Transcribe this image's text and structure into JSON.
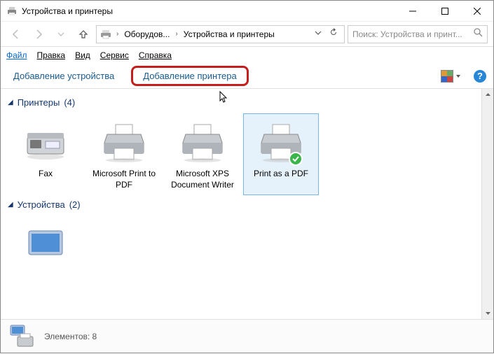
{
  "window": {
    "title": "Устройства и принтеры"
  },
  "breadcrumb": {
    "item1": "Оборудов...",
    "item2": "Устройства и принтеры"
  },
  "search": {
    "placeholder": "Поиск: Устройства и принт..."
  },
  "menu": {
    "file": "Файл",
    "edit": "Правка",
    "view": "Вид",
    "tools": "Сервис",
    "help": "Справка"
  },
  "commands": {
    "add_device": "Добавление устройства",
    "add_printer": "Добавление принтера"
  },
  "groups": {
    "printers": {
      "label": "Принтеры",
      "count": "(4)"
    },
    "devices": {
      "label": "Устройства",
      "count": "(2)"
    }
  },
  "printers": [
    {
      "label": "Fax"
    },
    {
      "label": "Microsoft Print to PDF"
    },
    {
      "label": "Microsoft XPS Document Writer"
    },
    {
      "label": "Print as a PDF"
    }
  ],
  "status": {
    "text": "Элементов: 8"
  }
}
